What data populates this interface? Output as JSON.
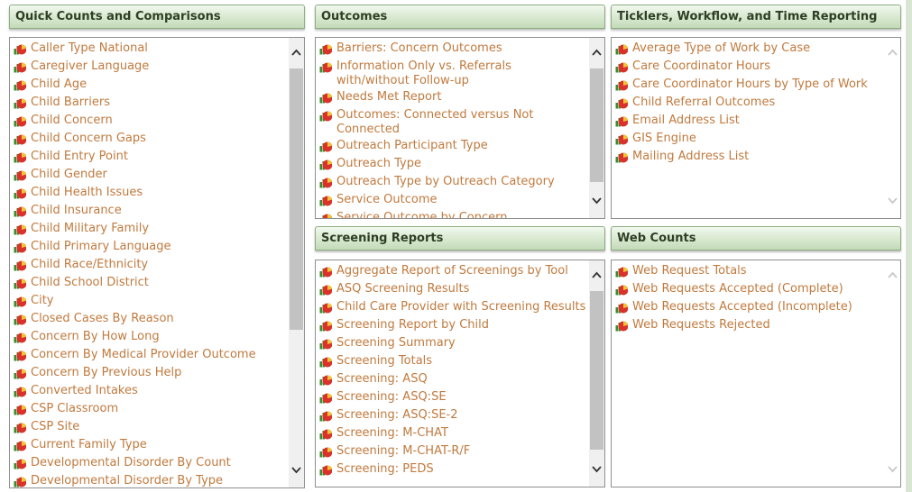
{
  "panels": {
    "quick_counts": {
      "title": "Quick Counts and Comparisons",
      "items": [
        "Caller Type National",
        "Caregiver Language",
        "Child Age",
        "Child Barriers",
        "Child Concern",
        "Child Concern Gaps",
        "Child Entry Point",
        "Child Gender",
        "Child Health Issues",
        "Child Insurance",
        "Child Military Family",
        "Child Primary Language",
        "Child Race/Ethnicity",
        "Child School District",
        "City",
        "Closed Cases By Reason",
        "Concern By How Long",
        "Concern By Medical Provider Outcome",
        "Concern By Previous Help",
        "Converted Intakes",
        "CSP Classroom",
        "CSP Site",
        "Current Family Type",
        "Developmental Disorder By Count",
        "Developmental Disorder By Type"
      ]
    },
    "outcomes": {
      "title": "Outcomes",
      "items": [
        "Barriers: Concern Outcomes",
        "Information Only vs. Referrals with/without Follow-up",
        "Needs Met Report",
        "Outcomes: Connected versus Not Connected",
        "Outreach Participant Type",
        "Outreach Type",
        "Outreach Type by Outreach Category",
        "Service Outcome",
        "Service Outcome by Concern"
      ]
    },
    "ticklers": {
      "title": "Ticklers, Workflow, and Time Reporting",
      "items": [
        "Average Type of Work by Case",
        "Care Coordinator Hours",
        "Care Coordinator Hours by Type of Work",
        "Child Referral Outcomes",
        "Email Address List",
        "GIS Engine",
        "Mailing Address List"
      ]
    },
    "screening": {
      "title": "Screening Reports",
      "items": [
        "Aggregate Report of Screenings by Tool",
        "ASQ Screening Results",
        "Child Care Provider with Screening Results",
        "Screening Report by Child",
        "Screening Summary",
        "Screening Totals",
        "Screening: ASQ",
        "Screening: ASQ:SE",
        "Screening: ASQ:SE-2",
        "Screening: M-CHAT",
        "Screening: M-CHAT-R/F",
        "Screening: PEDS"
      ]
    },
    "web_counts": {
      "title": "Web Counts",
      "items": [
        "Web Request Totals",
        "Web Requests Accepted (Complete)",
        "Web Requests Accepted (Incomplete)",
        "Web Requests Rejected"
      ]
    }
  },
  "icon": "report-chart-icon",
  "colors": {
    "link": "#c07a3e",
    "header_text": "#2d3f24",
    "header_bg": "#d7e8cf",
    "border": "#8f8f8f"
  }
}
